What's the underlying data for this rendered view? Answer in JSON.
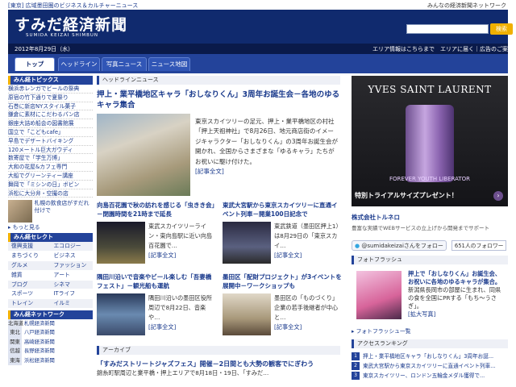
{
  "topstrip": {
    "left": "[東京] 広域墨田圏のビジネス＆カルチャーニュース",
    "right": "みんなの経済新聞ネットワーク"
  },
  "header": {
    "logo": "すみだ経済新聞",
    "logo_sub": "SUMIDA KEIZAI SHIMBUN",
    "search_placeholder": "",
    "search_button": "検索"
  },
  "datebar": {
    "date": "2012年8月29日（水）",
    "link1": "エリア情報はこちらまで",
    "link2": "エリアに届く｜広告のご案内"
  },
  "tabs": [
    "トップ",
    "ヘッドライン",
    "写真ニュース",
    "ニュース地図"
  ],
  "sidebar": {
    "topics_title": "みん経トピックス",
    "topics": [
      "横浜赤レンガでビールの祭典",
      "原宿の竹下通りで夏祭り",
      "石巻に新店NYスタイル菓子",
      "鎌倉に素材にこだわるパン店",
      "銀座大詰め船会の図書館展",
      "国立で「こどもcafe」",
      "早島でデザートバイキング",
      "120メートル巨大ガウディ",
      "数寄屋で「学生万博」",
      "大和の花屋&カフェ専門",
      "大船でグリーンティー講座",
      "舞岡で「ミシンの日」ボビン",
      "浜松に大分弁・空撮の店"
    ],
    "thumb_text": "札幌の飲食店がすだれ付けで",
    "more": "もっと見る",
    "select_title": "みん経セレクト",
    "select": [
      "復興支援",
      "エコロジー",
      "まちづくり",
      "ビジネス",
      "グルメ",
      "ファッション",
      "雑貨",
      "アート",
      "ブログ",
      "シネマ",
      "スポーツ",
      "ITライフ",
      "トレイン",
      "イルミ"
    ],
    "network_title": "みん経ネットワーク",
    "network": [
      {
        "k": "北海道",
        "v": "札幌経済新聞"
      },
      {
        "k": "東北",
        "v": "八戸経済新聞"
      },
      {
        "k": "関東",
        "v": "高崎経済新聞"
      },
      {
        "k": "信越",
        "v": "長野経済新聞"
      },
      {
        "k": "東海",
        "v": "浜松経済新聞"
      }
    ]
  },
  "main": {
    "section1": "ヘッドラインニュース",
    "lead_title": "押上・業平橋地区キャラ「おしなりくん」3周年お誕生会－各地のゆるキャラ集合",
    "lead_body": "東京スカイツリーの足元、押上・業平橋地区の村社「押上天祖神社」で8月26日、地元商店街のイメージキャラクター「おしなりくん」の3周年お誕生会が開かれ、全国からさまざまな「ゆるキャラ」たちがお祝いに駆け付けた。",
    "readmore": "[記事全文]",
    "cards": [
      {
        "title": "向島百花園で秋の訪れを感じる「虫きき会」－閉園時間を21時まで延長",
        "body": "東武スカイツリーライン・東向島駅に近い向島百花園で…",
        "more": "[記事全文]"
      },
      {
        "title": "東武大宮駅から東京スカイツリーに直通イベント列車－開業100日記念で",
        "body": "東武鉄道（墨田区押上1）は8月29日の「東京スカイ…",
        "more": "[記事全文]"
      },
      {
        "title": "隅田川沿いで音楽やビール楽しむ「吾妻橋フェスト」－観光船も運航",
        "body": "隅田川沿いの墨田区役所周辺で8月22日、音楽や…",
        "more": "[記事全文]"
      },
      {
        "title": "墨田区「配財プロジェクト」が3イベントを展開中－ワークショップも",
        "body": "墨田区の「ものづくり」企業の若手後継者が中心と…",
        "more": "[記事全文]"
      }
    ],
    "archive_title_label": "アーカイブ",
    "archive_title": "「すみだストリートジャズフェス」開催－2日間とも大勢の観客でにぎわう",
    "archive_body": "錦糸町駅周辺と業平橋・押上エリアで8月18日・19日、「すみだ…"
  },
  "right": {
    "ad_brand": "YVES SAINT LAURENT",
    "ad_forever": "FOREVER YOUTH LIBERATOR",
    "ad_cta": "特別トライアルサイズプレゼント！",
    "ad_arrow": "›",
    "sponsor_name": "株式会社トルネロ",
    "sponsor_desc": "豊富な実績でWEBサービスの立上げから開発までサポート",
    "follow_btn": "@sumidakeizaiさんをフォロー",
    "follow_count": "651人のフォロワー",
    "flash_title": "フォトフラッシュ",
    "flash_bold": "押上で「おしなりくん」お誕生会、お祝いに各地のゆるキャラが集合。",
    "flash_text": "新潟県長岡市の部屋に生まれ、同県の食を全国にPRする「もち～うさぎ」。",
    "flash_more": "[拡大写真]",
    "flash_link": "フォトフラッシュ一覧",
    "ranking_title": "アクセスランキング",
    "ranking": [
      {
        "n": "1",
        "t": "押上・業平橋地区キャラ「おしなりくん」3周年お誕..."
      },
      {
        "n": "2",
        "t": "東武大宮駅から東京スカイツリーに直通イベント列車..."
      },
      {
        "n": "3",
        "t": "東京スカイツリー、ロンドン五輪金メダル獲得で..."
      }
    ]
  }
}
